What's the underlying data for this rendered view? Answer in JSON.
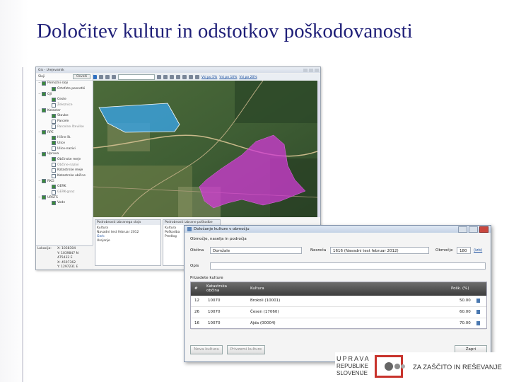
{
  "slide": {
    "title": "Določitev kultur in odstotkov poškodovanosti"
  },
  "gis": {
    "window_title": "Gis - Urejevalnik",
    "sidebar_heading": "Sloji",
    "sidebar_button": "Osveži",
    "toolbar_links": [
      "Vsi po 5%",
      "Vsi po 10%",
      "Vsi po 20%"
    ],
    "layers": [
      {
        "label": "Pomožni sloji",
        "level": 1,
        "checked": true,
        "muted": false
      },
      {
        "label": "Ortofoto posnetki",
        "level": 2,
        "checked": true,
        "muted": false
      },
      {
        "label": "GJI",
        "level": 1,
        "checked": true,
        "muted": false
      },
      {
        "label": "Ceste",
        "level": 2,
        "checked": true,
        "muted": false
      },
      {
        "label": "Železnice",
        "level": 2,
        "checked": false,
        "muted": true
      },
      {
        "label": "Kataster",
        "level": 1,
        "checked": true,
        "muted": false
      },
      {
        "label": "Stavbe",
        "level": 2,
        "checked": true,
        "muted": false
      },
      {
        "label": "Parcele",
        "level": 2,
        "checked": false,
        "muted": false
      },
      {
        "label": "Parcelne številke",
        "level": 2,
        "checked": false,
        "muted": true
      },
      {
        "label": "RPE",
        "level": 1,
        "checked": true,
        "muted": false
      },
      {
        "label": "Hišne št.",
        "level": 2,
        "checked": true,
        "muted": false
      },
      {
        "label": "Ulice",
        "level": 2,
        "checked": true,
        "muted": false
      },
      {
        "label": "Ulice-nazivi",
        "level": 2,
        "checked": false,
        "muted": false
      },
      {
        "label": "Uprava",
        "level": 1,
        "checked": true,
        "muted": false
      },
      {
        "label": "Občinske meje",
        "level": 2,
        "checked": true,
        "muted": false
      },
      {
        "label": "Občine-nazivi",
        "level": 2,
        "checked": false,
        "muted": true
      },
      {
        "label": "Katastrske meje",
        "level": 2,
        "checked": false,
        "muted": false
      },
      {
        "label": "Katastrske občine",
        "level": 2,
        "checked": false,
        "muted": false
      },
      {
        "label": "RKG",
        "level": 1,
        "checked": true,
        "muted": false
      },
      {
        "label": "GERK",
        "level": 2,
        "checked": true,
        "muted": false
      },
      {
        "label": "GERK-gnaz",
        "level": 2,
        "checked": false,
        "muted": true
      },
      {
        "label": "URSTS",
        "level": 1,
        "checked": true,
        "muted": false
      },
      {
        "label": "Vode",
        "level": 2,
        "checked": true,
        "muted": false
      }
    ],
    "coordinates": {
      "label": "Lokacija:",
      "lines": [
        "X: 1038304",
        "Y: 1039847 N",
        "475432 E",
        "X: 4597362",
        "Y: 1297231 E"
      ]
    },
    "panel_left": {
      "title": "Podrobnosti izbranega sloja",
      "items": [
        "Kultura",
        "Navadni test februar 2012",
        "Gerk",
        "Urejanje"
      ]
    },
    "panel_right": {
      "title": "Podrobnosti izbrane poškodbe",
      "items": [
        "Kultura",
        "Poškodba",
        "Predlog"
      ]
    },
    "colors": {
      "blue_polygon": "#3aa3e3",
      "magenta_polygon": "#d23ad6"
    }
  },
  "dialog": {
    "title": "Določanje kulture v območju",
    "section_area": "Območje, naselja in področja",
    "label_obcina": "Občina",
    "value_obcina": "Domžale",
    "label_nesreca": "Nesreča",
    "value_nesreca": "1616 (Navadni test februar 2012)",
    "label_obmocje": "Območje",
    "value_obmocje": "180",
    "link_izb": "(izb)",
    "label_opis": "Opis",
    "value_opis": "",
    "section_crops": "Prizadete kulture",
    "columns": [
      "#",
      "Katastrska občina",
      "Kultura",
      "Pošk. (%)"
    ],
    "rows": [
      {
        "num": "12",
        "ko": "10070",
        "kultura": "Brokoli (10001)",
        "poskodba": "50.00"
      },
      {
        "num": "26",
        "ko": "10070",
        "kultura": "Česen (17060)",
        "poskodba": "60.00"
      },
      {
        "num": "16",
        "ko": "10070",
        "kultura": "Ajda (00004)",
        "poskodba": "70.00"
      }
    ],
    "btn_new": "Nova kultura",
    "btn_remove": "Privzemi kulture",
    "btn_close": "Zapri"
  },
  "logo": {
    "lines": [
      "UPRAVA",
      "REPUBLIKE",
      "SLOVENIJE"
    ],
    "tagline": "ZA ZAŠČITO IN REŠEVANJE",
    "color": "#c8332c"
  }
}
